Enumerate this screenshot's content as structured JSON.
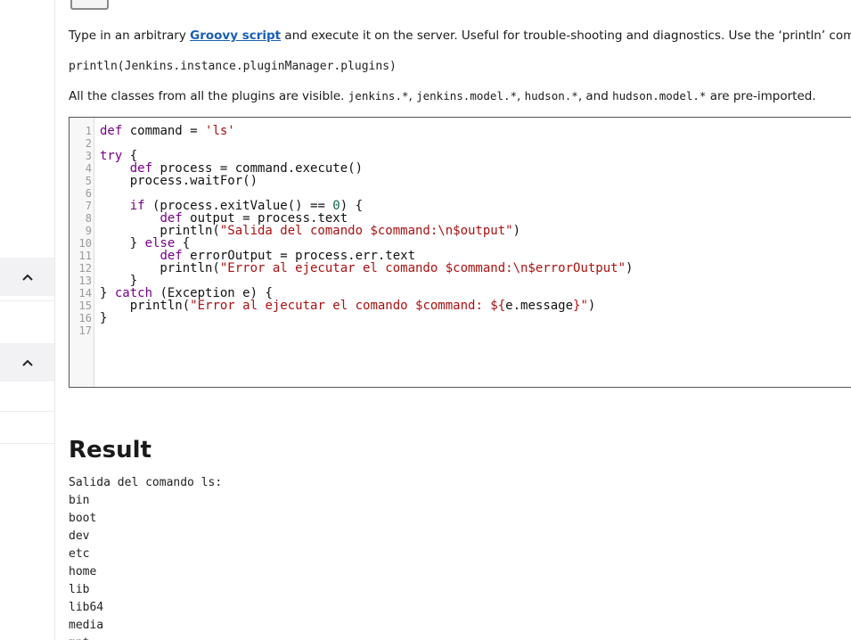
{
  "description": {
    "prefix": "Type in an arbitrary ",
    "link": "Groovy script",
    "suffix": " and execute it on the server. Useful for trouble-shooting and diagnostics. Use the ‘println’ command to see th"
  },
  "example_command": "println(Jenkins.instance.pluginManager.plugins)",
  "classes_note": {
    "part1": "All the classes from all the plugins are visible. ",
    "c1": "jenkins.*",
    "sep1": ", ",
    "c2": "jenkins.model.*",
    "sep2": ", ",
    "c3": "hudson.*",
    "sep3": ", and ",
    "c4": "hudson.model.*",
    "part2": " are pre-imported."
  },
  "editor": {
    "line_numbers": [
      "1",
      "2",
      "3",
      "4",
      "5",
      "6",
      "7",
      "8",
      "9",
      "10",
      "11",
      "12",
      "13",
      "14",
      "15",
      "16",
      "17"
    ]
  },
  "result": {
    "title": "Result",
    "output_lines": [
      "Salida del comando ls:",
      "bin",
      "boot",
      "dev",
      "etc",
      "home",
      "lib",
      "lib64",
      "media",
      "mnt"
    ]
  },
  "icons": {
    "toggle_1": "chevron-up-icon",
    "toggle_2": "chevron-up-icon"
  }
}
